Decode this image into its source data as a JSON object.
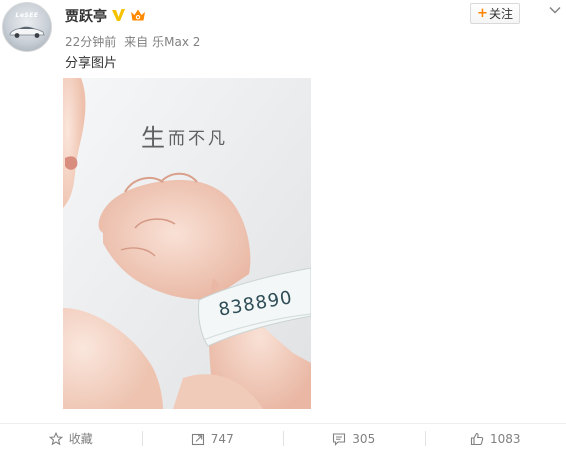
{
  "author": {
    "name": "贾跃亭",
    "avatar_logo_text": "LeSEE"
  },
  "follow_button": {
    "plus": "+",
    "label": "关注"
  },
  "meta": {
    "time": "22分钟前",
    "source_prefix": "来自",
    "device": "乐Max 2"
  },
  "post": {
    "text": "分享图片"
  },
  "image": {
    "caption_first": "生",
    "caption_rest": "而不凡",
    "wristband_number": "838890"
  },
  "actions": {
    "favorite": {
      "label": "收藏"
    },
    "repost": {
      "count": "747"
    },
    "comment": {
      "count": "305"
    },
    "like": {
      "count": "1083"
    }
  },
  "colors": {
    "accent_orange": "#ff8200",
    "verified_yellow": "#f6c200",
    "muted_text": "#808080"
  },
  "icons": [
    "car-logo-icon",
    "verified-v-icon",
    "vip-crown-icon",
    "chevron-down-icon",
    "star-icon",
    "repost-icon",
    "comment-icon",
    "thumbs-up-icon"
  ]
}
